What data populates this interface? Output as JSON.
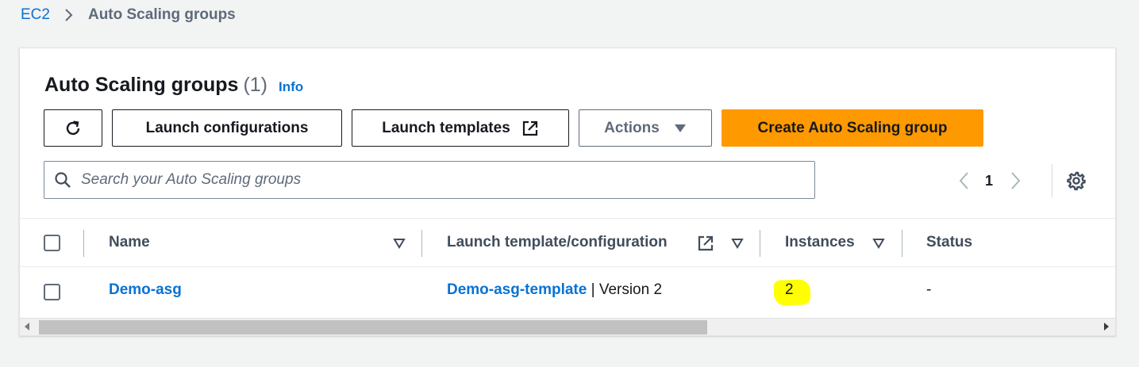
{
  "breadcrumb": {
    "items": [
      "EC2",
      "Auto Scaling groups"
    ],
    "separator_icon": "chevron-right-icon"
  },
  "panel": {
    "title": "Auto Scaling groups",
    "count": "(1)",
    "info_label": "Info"
  },
  "toolbar": {
    "refresh_icon": "refresh-icon",
    "launch_configurations_label": "Launch configurations",
    "launch_templates_label": "Launch templates",
    "external_link_icon": "external-link-icon",
    "actions_label": "Actions",
    "actions_icon": "caret-down-icon",
    "create_label": "Create Auto Scaling group"
  },
  "search": {
    "placeholder": "Search your Auto Scaling groups",
    "value": "",
    "icon": "search-icon"
  },
  "pagination": {
    "current_page": "1",
    "prev_icon": "chevron-left-icon",
    "next_icon": "chevron-right-icon",
    "settings_icon": "gear-icon"
  },
  "table": {
    "columns": [
      "Name",
      "Launch template/configuration",
      "Instances",
      "Status"
    ],
    "rows": [
      {
        "name": "Demo-asg",
        "launch_template": "Demo-asg-template",
        "version": " | Version 2",
        "instances": "2",
        "status": "-"
      }
    ]
  },
  "colors": {
    "link": "#0972d3",
    "primary_button": "#ff9900",
    "highlight": "#ffff00",
    "background": "#f2f3f3"
  }
}
